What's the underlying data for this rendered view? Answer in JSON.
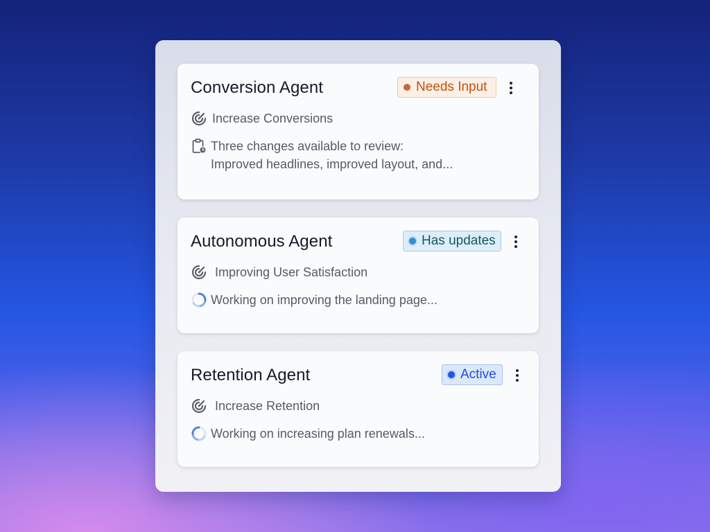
{
  "agents": [
    {
      "title": "Conversion Agent",
      "badge": {
        "label": "Needs Input",
        "text_color": "#c15410",
        "bg": "#fcefe5",
        "border": "#f5c9a8",
        "dot": "#c8693a"
      },
      "goal": {
        "icon": "target-icon",
        "label": "Increase Conversions"
      },
      "status": {
        "icon": "clipboard-clock-icon",
        "line1": "Three changes available to review:",
        "line2": "Improved headlines, improved layout, and..."
      }
    },
    {
      "title": "Autonomous Agent",
      "badge": {
        "label": "Has updates",
        "text_color": "#0b5e5a",
        "bg": "#dfedf8",
        "border": "#a9cbe6",
        "dot": "#2f8fd0"
      },
      "goal": {
        "icon": "target-icon",
        "label": "Improving User Satisfaction"
      },
      "status": {
        "icon": "loading-spinner-icon",
        "line1": "Working on improving the landing page..."
      }
    },
    {
      "title": "Retention Agent",
      "badge": {
        "label": "Active",
        "text_color": "#1f4ed8",
        "bg": "#dbe8f9",
        "border": "#a6c4ee",
        "dot": "#1f55e0"
      },
      "goal": {
        "icon": "target-icon",
        "label": "Increase Retention"
      },
      "status": {
        "icon": "loading-spinner-icon",
        "line1": "Working on increasing plan renewals..."
      }
    }
  ]
}
